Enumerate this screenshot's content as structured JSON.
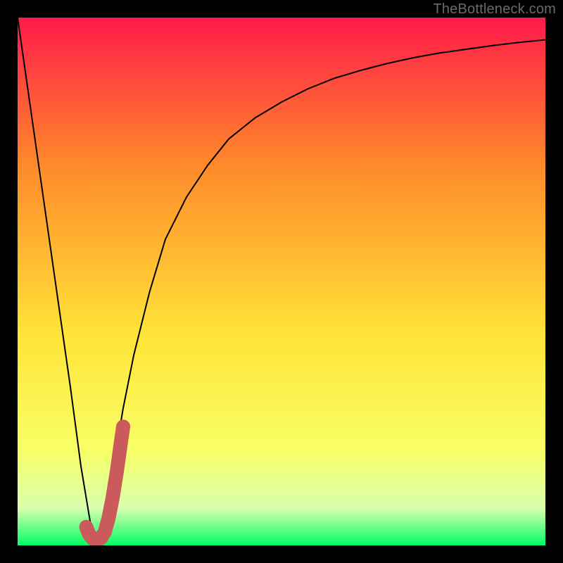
{
  "watermark": {
    "text": "TheBottleneck.com"
  },
  "colors": {
    "frame": "#000000",
    "grad_top": "#ff1a4a",
    "grad_mid1": "#ff8a2a",
    "grad_mid2": "#ffe438",
    "grad_low": "#f8ff66",
    "grad_band": "#d8ffad",
    "grad_bottom": "#00ff66",
    "curve": "#000000",
    "marker": "#cb5a5c"
  },
  "chart_data": {
    "type": "line",
    "title": "",
    "xlabel": "",
    "ylabel": "",
    "xlim": [
      0,
      100
    ],
    "ylim": [
      0,
      100
    ],
    "series": [
      {
        "name": "bottleneck-curve",
        "x": [
          0,
          5,
          10,
          12,
          14,
          15,
          16,
          18,
          20,
          22,
          25,
          28,
          32,
          36,
          40,
          45,
          50,
          55,
          60,
          65,
          70,
          75,
          80,
          85,
          90,
          95,
          100
        ],
        "values": [
          100,
          65,
          30,
          15,
          3,
          1,
          4,
          14,
          26,
          36,
          48,
          58,
          66,
          72,
          77,
          81,
          84,
          86.5,
          88.5,
          90,
          91.3,
          92.4,
          93.3,
          94,
          94.7,
          95.3,
          95.8
        ]
      },
      {
        "name": "highlight-j-marker",
        "x": [
          13.0,
          13.5,
          14.2,
          15.0,
          15.8,
          16.5,
          17.2,
          18.0,
          18.8,
          19.5,
          20.0
        ],
        "values": [
          3.5,
          2.2,
          1.3,
          1.0,
          1.4,
          2.5,
          5.0,
          9.0,
          14.0,
          19.0,
          22.5
        ]
      }
    ],
    "gradient_stops": [
      {
        "pct": 0,
        "color": "#ff1a4a"
      },
      {
        "pct": 28,
        "color": "#ff8a2a"
      },
      {
        "pct": 60,
        "color": "#ffe438"
      },
      {
        "pct": 82,
        "color": "#f8ff66"
      },
      {
        "pct": 93,
        "color": "#d8ffad"
      },
      {
        "pct": 100,
        "color": "#00ff66"
      }
    ]
  }
}
